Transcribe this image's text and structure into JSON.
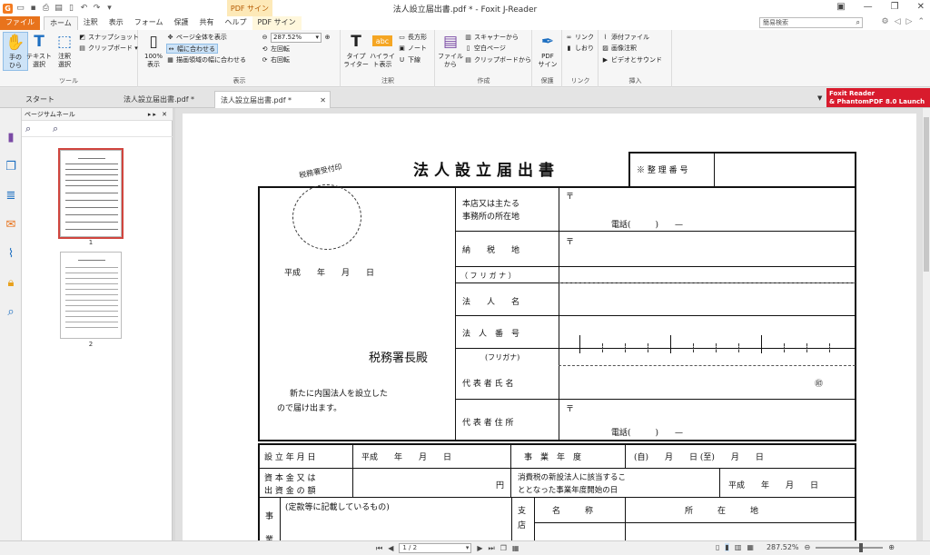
{
  "window": {
    "title": "法人設立届出書.pdf * - Foxit J-Reader",
    "context_tab_header": "PDF サイン"
  },
  "ribbon_tabs": [
    "ファイル",
    "ホーム",
    "注釈",
    "表示",
    "フォーム",
    "保護",
    "共有",
    "ヘルプ",
    "PDF サイン"
  ],
  "search": {
    "label": "簡易検索",
    "placeholder": ""
  },
  "ribbon": {
    "tools": {
      "label": "ツール",
      "hand": "手の\nひら",
      "text_select": "テキスト\n選択",
      "annot_select": "注釈\n選択",
      "snapshot": "スナップショット",
      "clipboard": "クリップボード ▾"
    },
    "view": {
      "label": "表示",
      "actual": "100%\n表示",
      "fit_page": "ページ全体を表示",
      "fit_width": "幅に合わせる",
      "fit_visible": "描画領域の幅に合わせる",
      "zoom": "287.52%",
      "rotate_left": "左回転",
      "rotate_right": "右回転"
    },
    "annot": {
      "label": "注釈",
      "typewriter": "タイプ\nライター",
      "highlight": "ハイライ\nト表示",
      "rectangle": "長方形",
      "note": "ノート",
      "underline": "下線"
    },
    "create": {
      "label": "作成",
      "from_file": "ファイル\nから",
      "scanner": "スキャナーから",
      "blank": "空白ページ",
      "clipboard": "クリップボードから"
    },
    "protect": {
      "label": "保護",
      "pdf_sign": "PDF\nサイン"
    },
    "link": {
      "label": "リンク",
      "link": "リンク",
      "bookmark": "しおり"
    },
    "insert": {
      "label": "挿入",
      "attach": "添付ファイル",
      "image": "画像注釈",
      "video": "ビデオとサウンド"
    }
  },
  "doc_tabs": [
    {
      "label": "スタート"
    },
    {
      "label": "法人設立届出書.pdf *"
    },
    {
      "label": "法人設立届出書.pdf *"
    }
  ],
  "promo": {
    "line1": "Foxit Reader",
    "line2": "& PhantomPDF 8.0 Launch"
  },
  "thumb_panel": {
    "title": "ページサムネール",
    "pages": [
      "1",
      "2"
    ]
  },
  "form": {
    "title": "法人設立届出書",
    "stamp_label": "税務署受付印",
    "ref_number": "※ 整 理 番 号",
    "date_left": "平成　　年　　月　　日",
    "addressee": "税務署長殿",
    "statement1": "新たに内国法人を設立した",
    "statement2": "ので届け出ます。",
    "hq_label1": "本店又は主たる",
    "hq_label2": "事務所の所在地",
    "postal": "〒",
    "phone": "電話(　　　)　　—",
    "tax_place": "納　　税　　地",
    "furigana1": "（ フ リ ガ ナ ）",
    "corp_name": "法　　人　　名",
    "corp_number": "法　人　番　号",
    "furigana2": "(フリガナ)",
    "rep_name": "代 表 者 氏 名",
    "seal": "㊞",
    "rep_address": "代 表 者 住 所",
    "est_date": "設 立 年 月 日",
    "est_date_val": "平成　　年　　月　　日",
    "fiscal": "事　業　年　度",
    "fiscal_val": "(自)　　月　　日 (至)　　月　　日",
    "capital1": "資 本 金 又 は",
    "capital2": "出 資 金 の 額",
    "yen": "円",
    "consumption1": "消費税の新設法人に該当するこ",
    "consumption2": "ととなった事業年度開始の日",
    "consumption_val": "平成　　年　　月　　日",
    "business": "事",
    "business2": "業",
    "purpose": "(定款等に記載しているもの)",
    "branch1": "支",
    "branch2": "店",
    "branch_name": "名　　　称",
    "branch_loc": "所　　　在　　　地"
  },
  "status": {
    "page": "1 / 2",
    "zoom": "287.52%"
  }
}
